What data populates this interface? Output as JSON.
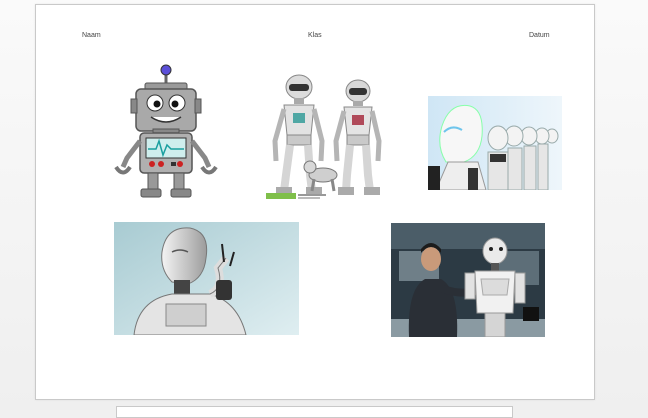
{
  "header": {
    "name_label": "Naam",
    "class_label": "Klas",
    "date_label": "Datum"
  },
  "images": [
    {
      "name": "cartoon-robot-image"
    },
    {
      "name": "twin-robots-image"
    },
    {
      "name": "robot-row-image"
    },
    {
      "name": "humanoid-robot-image"
    },
    {
      "name": "engineer-robot-image"
    }
  ]
}
